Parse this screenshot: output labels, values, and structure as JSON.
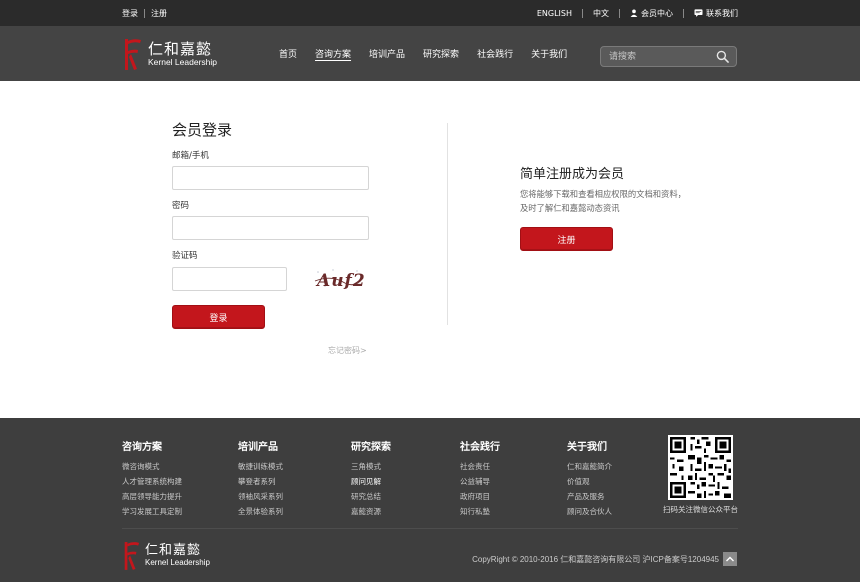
{
  "topbar": {
    "login": "登录",
    "register": "注册",
    "english": "ENGLISH",
    "chinese": "中文",
    "member_center": "会员中心",
    "contact": "联系我们"
  },
  "header": {
    "logo_cn": "仁和嘉懿",
    "logo_en": "Kernel Leadership",
    "nav": [
      {
        "label": "首页"
      },
      {
        "label": "咨询方案",
        "active": true
      },
      {
        "label": "培训产品"
      },
      {
        "label": "研究探索"
      },
      {
        "label": "社会践行"
      },
      {
        "label": "关于我们"
      }
    ],
    "search_placeholder": "请搜索"
  },
  "login": {
    "title": "会员登录",
    "email_label": "邮箱/手机",
    "password_label": "密码",
    "captcha_label": "验证码",
    "captcha_text": "Auf2",
    "submit": "登录",
    "forgot": "忘记密码>"
  },
  "register": {
    "title": "简单注册成为会员",
    "line1": "您将能够下载和查看相应权限的文档和资料，",
    "line2": "及时了解仁和嘉懿动态资讯",
    "button": "注册"
  },
  "footer": {
    "columns": [
      {
        "title": "咨询方案",
        "links": [
          "微咨询模式",
          "人才管理系统构建",
          "高层领导能力提升",
          "学习发展工具定制"
        ]
      },
      {
        "title": "培训产品",
        "links": [
          "敏捷训练模式",
          "攀登者系列",
          "领袖风采系列",
          "全景体验系列"
        ]
      },
      {
        "title": "研究探索",
        "links": [
          "三角模式",
          "顾问见解",
          "研究总结",
          "嘉懿资源"
        ]
      },
      {
        "title": "社会践行",
        "links": [
          "社会责任",
          "公益辅导",
          "政府项目",
          "知行私塾"
        ]
      },
      {
        "title": "关于我们",
        "links": [
          "仁和嘉懿简介",
          "价值观",
          "产品及服务",
          "顾问及合伙人"
        ]
      }
    ],
    "qr_caption": "扫码关注微信公众平台",
    "logo_cn": "仁和嘉懿",
    "logo_en": "Kernel Leadership",
    "copyright": "CopyRight © 2010-2016 仁和嘉懿咨询有限公司 沪ICP备案号1204945"
  },
  "colors": {
    "brand_red": "#c3161c",
    "topbar": "#2b2b2b",
    "header": "#444444",
    "footer": "#3e3e3e"
  }
}
